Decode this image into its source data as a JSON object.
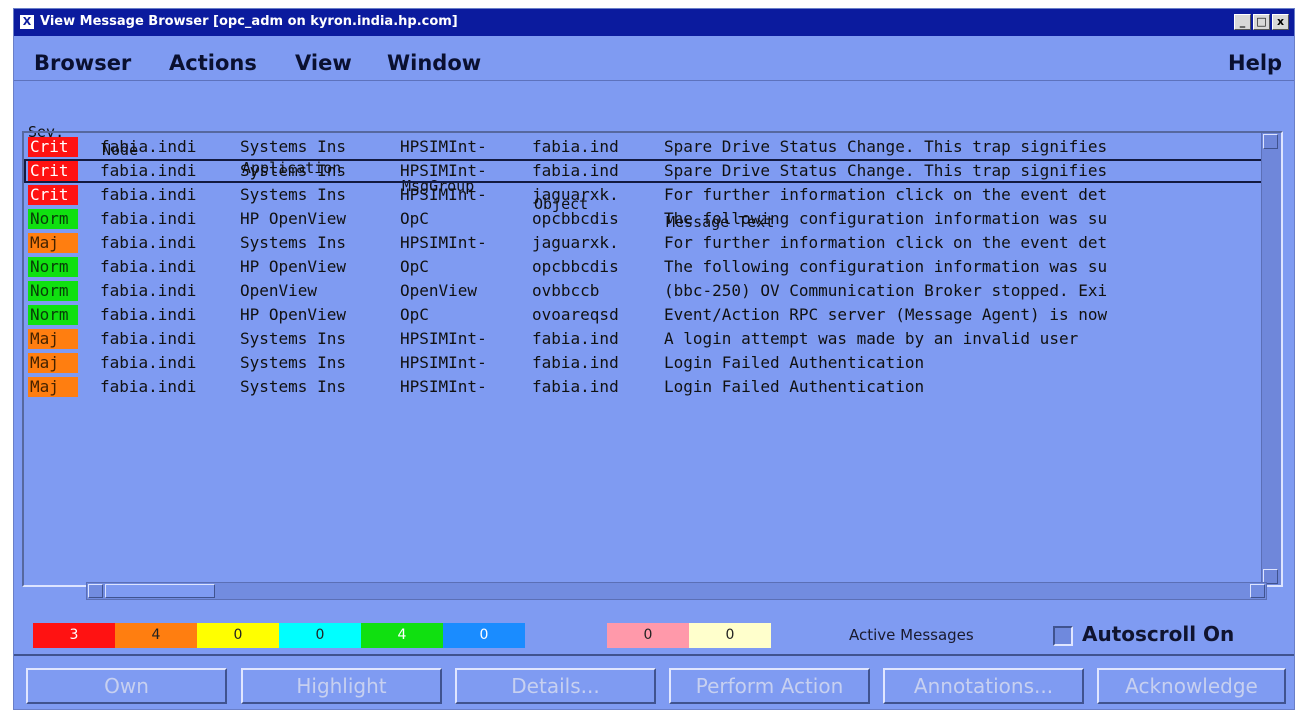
{
  "window": {
    "title": "View Message Browser  [opc_adm on kyron.india.hp.com]",
    "icon": "app-x-icon",
    "controls": [
      "_",
      "□",
      "x"
    ]
  },
  "menubar": {
    "browser": "Browser",
    "actions": "Actions",
    "view": "View",
    "window": "Window",
    "help": "Help"
  },
  "columns": {
    "sev": "Sev.",
    "node": "Node",
    "application": "Application",
    "msggroup": "MsgGroup",
    "object": "Object",
    "message": "Message Text"
  },
  "rows": [
    {
      "sev": "Crit",
      "node": "fabia.indi",
      "app": "Systems Ins",
      "group": "HPSIMInt-",
      "object": "fabia.ind",
      "text": "Spare Drive Status Change. This trap signifies"
    },
    {
      "sev": "Crit",
      "node": "fabia.indi",
      "app": "Systems Ins",
      "group": "HPSIMInt-",
      "object": "fabia.ind",
      "text": "Spare Drive Status Change. This trap signifies"
    },
    {
      "sev": "Crit",
      "node": "fabia.indi",
      "app": "Systems Ins",
      "group": "HPSIMInt-",
      "object": "jaguarxk.",
      "text": "For further information click on the event det"
    },
    {
      "sev": "Norm",
      "node": "fabia.indi",
      "app": "HP OpenView",
      "group": "OpC",
      "object": "opcbbcdis",
      "text": "The following configuration information was su"
    },
    {
      "sev": "Maj",
      "node": "fabia.indi",
      "app": "Systems Ins",
      "group": "HPSIMInt-",
      "object": "jaguarxk.",
      "text": "For further information click on the event det"
    },
    {
      "sev": "Norm",
      "node": "fabia.indi",
      "app": "HP OpenView",
      "group": "OpC",
      "object": "opcbbcdis",
      "text": "The following configuration information was su"
    },
    {
      "sev": "Norm",
      "node": "fabia.indi",
      "app": "OpenView",
      "group": "OpenView",
      "object": "ovbbccb",
      "text": "(bbc-250) OV Communication Broker stopped. Exi"
    },
    {
      "sev": "Norm",
      "node": "fabia.indi",
      "app": "HP OpenView",
      "group": "OpC",
      "object": "ovoareqsd",
      "text": "Event/Action RPC server (Message Agent) is now"
    },
    {
      "sev": "Maj",
      "node": "fabia.indi",
      "app": "Systems Ins",
      "group": "HPSIMInt-",
      "object": "fabia.ind",
      "text": "A login attempt was made by an invalid user"
    },
    {
      "sev": "Maj",
      "node": "fabia.indi",
      "app": "Systems Ins",
      "group": "HPSIMInt-",
      "object": "fabia.ind",
      "text": "Login Failed Authentication"
    },
    {
      "sev": "Maj",
      "node": "fabia.indi",
      "app": "Systems Ins",
      "group": "HPSIMInt-",
      "object": "fabia.ind",
      "text": "Login Failed Authentication"
    }
  ],
  "counts": [
    {
      "value": "3",
      "color": "#ff1212"
    },
    {
      "value": "4",
      "color": "#ff7e10"
    },
    {
      "value": "0",
      "color": "#ffff00"
    },
    {
      "value": "0",
      "color": "#00ffff"
    },
    {
      "value": "4",
      "color": "#10e010"
    },
    {
      "value": "0",
      "color": "#1a8cff"
    },
    {
      "value": "0",
      "color": "#ff99aa"
    },
    {
      "value": "0",
      "color": "#ffffcc"
    }
  ],
  "status": {
    "active_messages": "Active Messages",
    "autoscroll": "Autoscroll On"
  },
  "buttons": {
    "own": "Own",
    "highlight": "Highlight",
    "details": "Details...",
    "perform": "Perform Action",
    "annotations": "Annotations...",
    "acknowledge": "Acknowledge"
  }
}
